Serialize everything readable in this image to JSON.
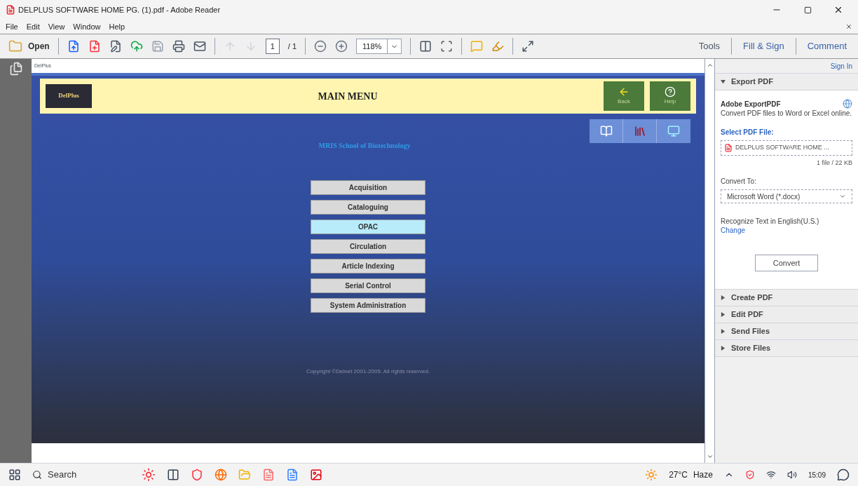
{
  "window": {
    "title": "DELPLUS SOFTWARE HOME PG. (1).pdf - Adobe Reader"
  },
  "menu": [
    "File",
    "Edit",
    "View",
    "Window",
    "Help"
  ],
  "toolbar": {
    "open_label": "Open",
    "page_current": "1",
    "page_total": "/ 1",
    "zoom": "118%"
  },
  "panel_tabs": [
    {
      "label": "Tools",
      "selected": false
    },
    {
      "label": "Fill & Sign",
      "selected": false
    },
    {
      "label": "Comment",
      "selected": false
    }
  ],
  "document": {
    "page_label": "DelPlus",
    "logo_text": "DelPlus",
    "heading": "MAIN MENU",
    "header_buttons": [
      "Back",
      "Help"
    ],
    "subtitle": "MRIS School of Biotechnology",
    "menu_buttons": [
      {
        "label": "Acquisition",
        "selected": false
      },
      {
        "label": "Cataloguing",
        "selected": false
      },
      {
        "label": "OPAC",
        "selected": true
      },
      {
        "label": "Circulation",
        "selected": false
      },
      {
        "label": "Article Indexing",
        "selected": false
      },
      {
        "label": "Serial Control",
        "selected": false
      },
      {
        "label": "System Administration",
        "selected": false
      }
    ],
    "copyright": "Copyright ©Delnet 2001-2005. All rights reserved."
  },
  "right_pane": {
    "sign_in": "Sign In",
    "sections": [
      {
        "title": "Export PDF",
        "expanded": true
      },
      {
        "title": "Create PDF",
        "expanded": false
      },
      {
        "title": "Edit PDF",
        "expanded": false
      },
      {
        "title": "Send Files",
        "expanded": false
      },
      {
        "title": "Store Files",
        "expanded": false
      }
    ],
    "export": {
      "title": "Adobe ExportPDF",
      "description": "Convert PDF files to Word or Excel online.",
      "select_label": "Select PDF File:",
      "file_name": "DELPLUS SOFTWARE HOME ...",
      "file_info": "1 file / 22 KB",
      "convert_to_label": "Convert To:",
      "convert_to_value": "Microsoft Word (*.docx)",
      "recognize_text": "Recognize Text in English(U.S.)",
      "change_link": "Change",
      "convert_button": "Convert"
    }
  },
  "taskbar": {
    "search": "Search",
    "temperature": "27°C",
    "weather": "Haze",
    "time": "15:09"
  }
}
